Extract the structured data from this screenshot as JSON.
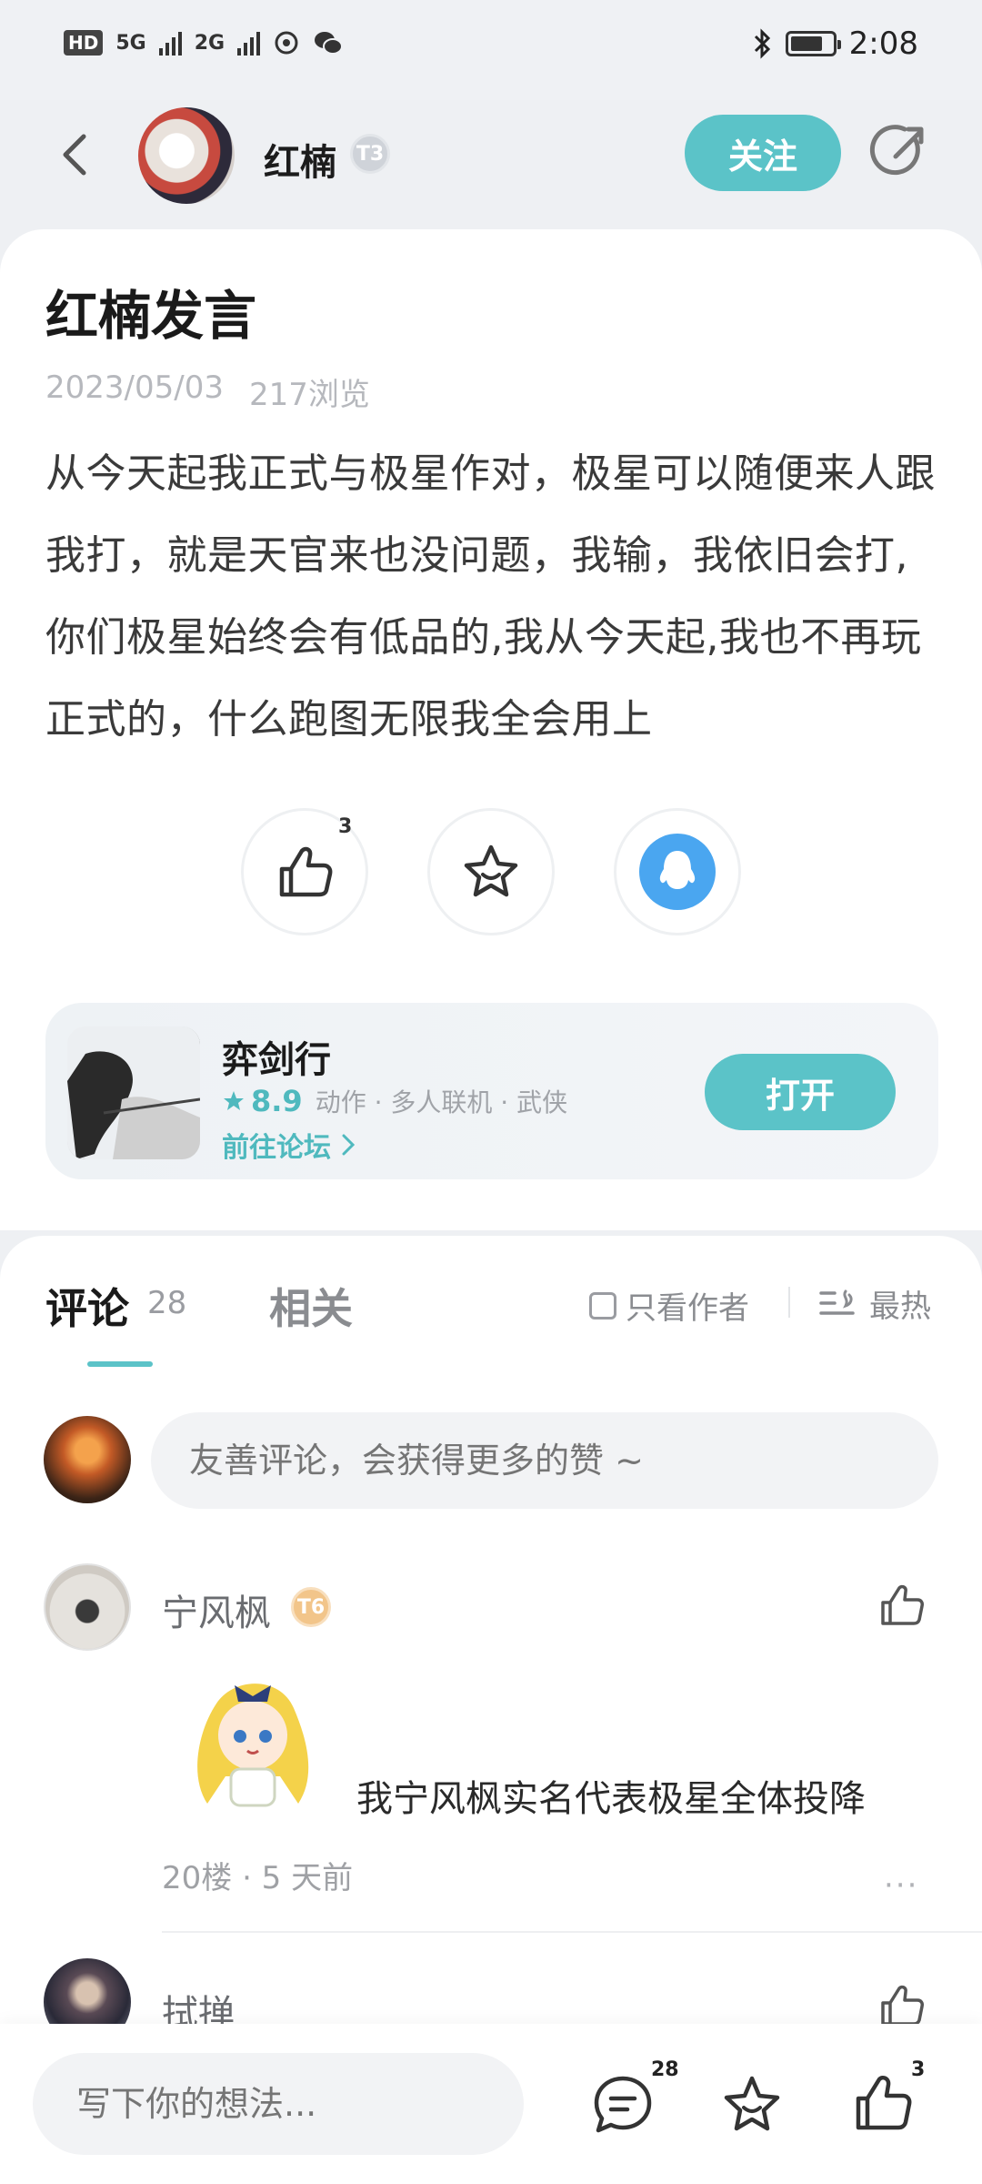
{
  "status_bar": {
    "network_1": "5G",
    "network_2": "2G",
    "hd": "HD",
    "time": "2:08"
  },
  "header": {
    "username": "红楠",
    "level_badge": "T3",
    "follow_label": "关注"
  },
  "post": {
    "title": "红楠发言",
    "date": "2023/05/03",
    "views": "217浏览",
    "body": "从今天起我正式与极星作对，极星可以随便来人跟我打，就是天官来也没问题，我输，我依旧会打,你们极星始终会有低品的,我从今天起,我也不再玩正式的，什么跑图无限我全会用上",
    "like_count": "3"
  },
  "game": {
    "name": "弈剑行",
    "rating": "8.9",
    "tags": "动作 · 多人联机 · 武侠",
    "forum_link": "前往论坛",
    "open_label": "打开"
  },
  "comments": {
    "tab_comments": "评论",
    "comment_count": "28",
    "tab_related": "相关",
    "author_only": "只看作者",
    "sort_label": "最热",
    "input_placeholder": "友善评论，会获得更多的赞 ~",
    "items": [
      {
        "name": "宁风枫",
        "badge": "T6",
        "text": "我宁风枫实名代表极星全体投降",
        "meta": "20楼 · 5 天前",
        "more": "···"
      },
      {
        "name": "拭掸"
      }
    ]
  },
  "bottom_bar": {
    "input_placeholder": "写下你的想法...",
    "comment_count": "28",
    "like_count": "3"
  },
  "colors": {
    "accent": "#5bc3c8",
    "qq_blue": "#4aa6f0"
  }
}
